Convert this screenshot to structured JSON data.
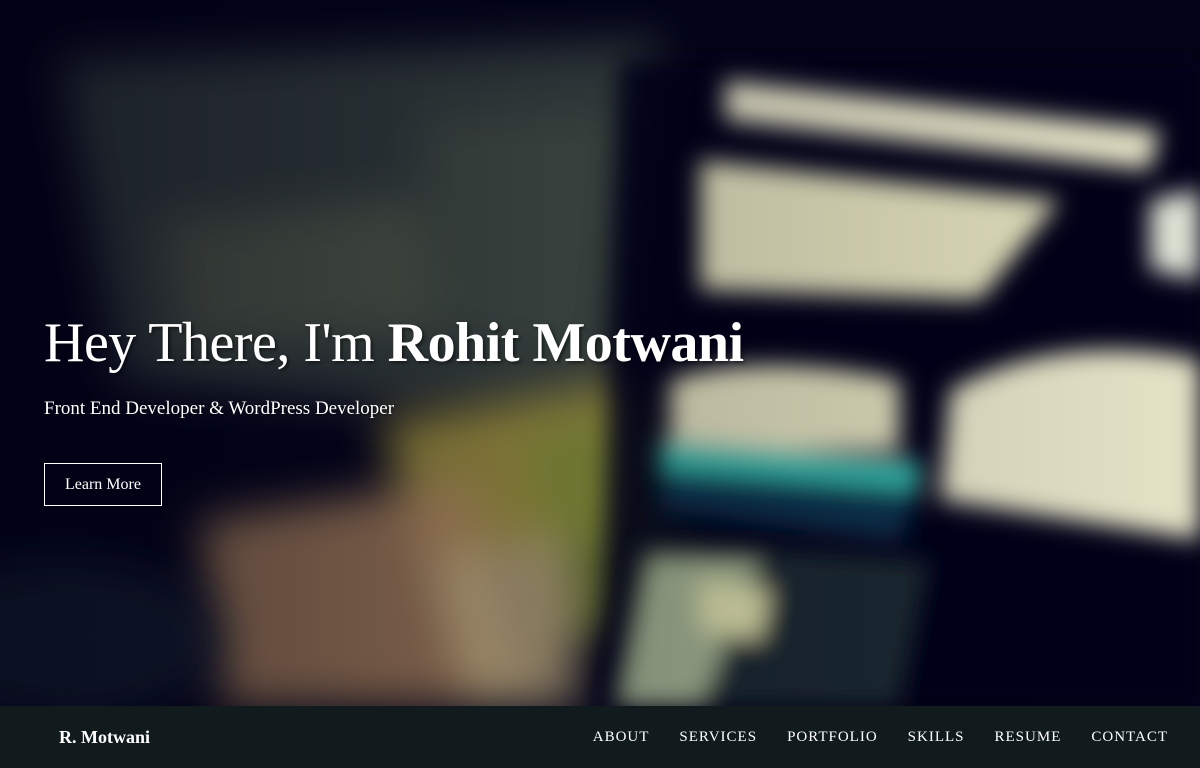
{
  "hero": {
    "greeting": "Hey There, I'm ",
    "name": "Rohit Motwani",
    "subtitle": "Front End Developer & WordPress Developer",
    "cta_label": "Learn More",
    "background": "blurred-laptop-photo"
  },
  "navbar": {
    "brand": "R. Motwani",
    "links": [
      {
        "label": "ABOUT"
      },
      {
        "label": "SERVICES"
      },
      {
        "label": "PORTFOLIO"
      },
      {
        "label": "SKILLS"
      },
      {
        "label": "RESUME"
      },
      {
        "label": "CONTACT"
      }
    ]
  },
  "colors": {
    "hero_base": "#03031a",
    "navbar_bg": "#111b1e",
    "text": "#ffffff"
  }
}
